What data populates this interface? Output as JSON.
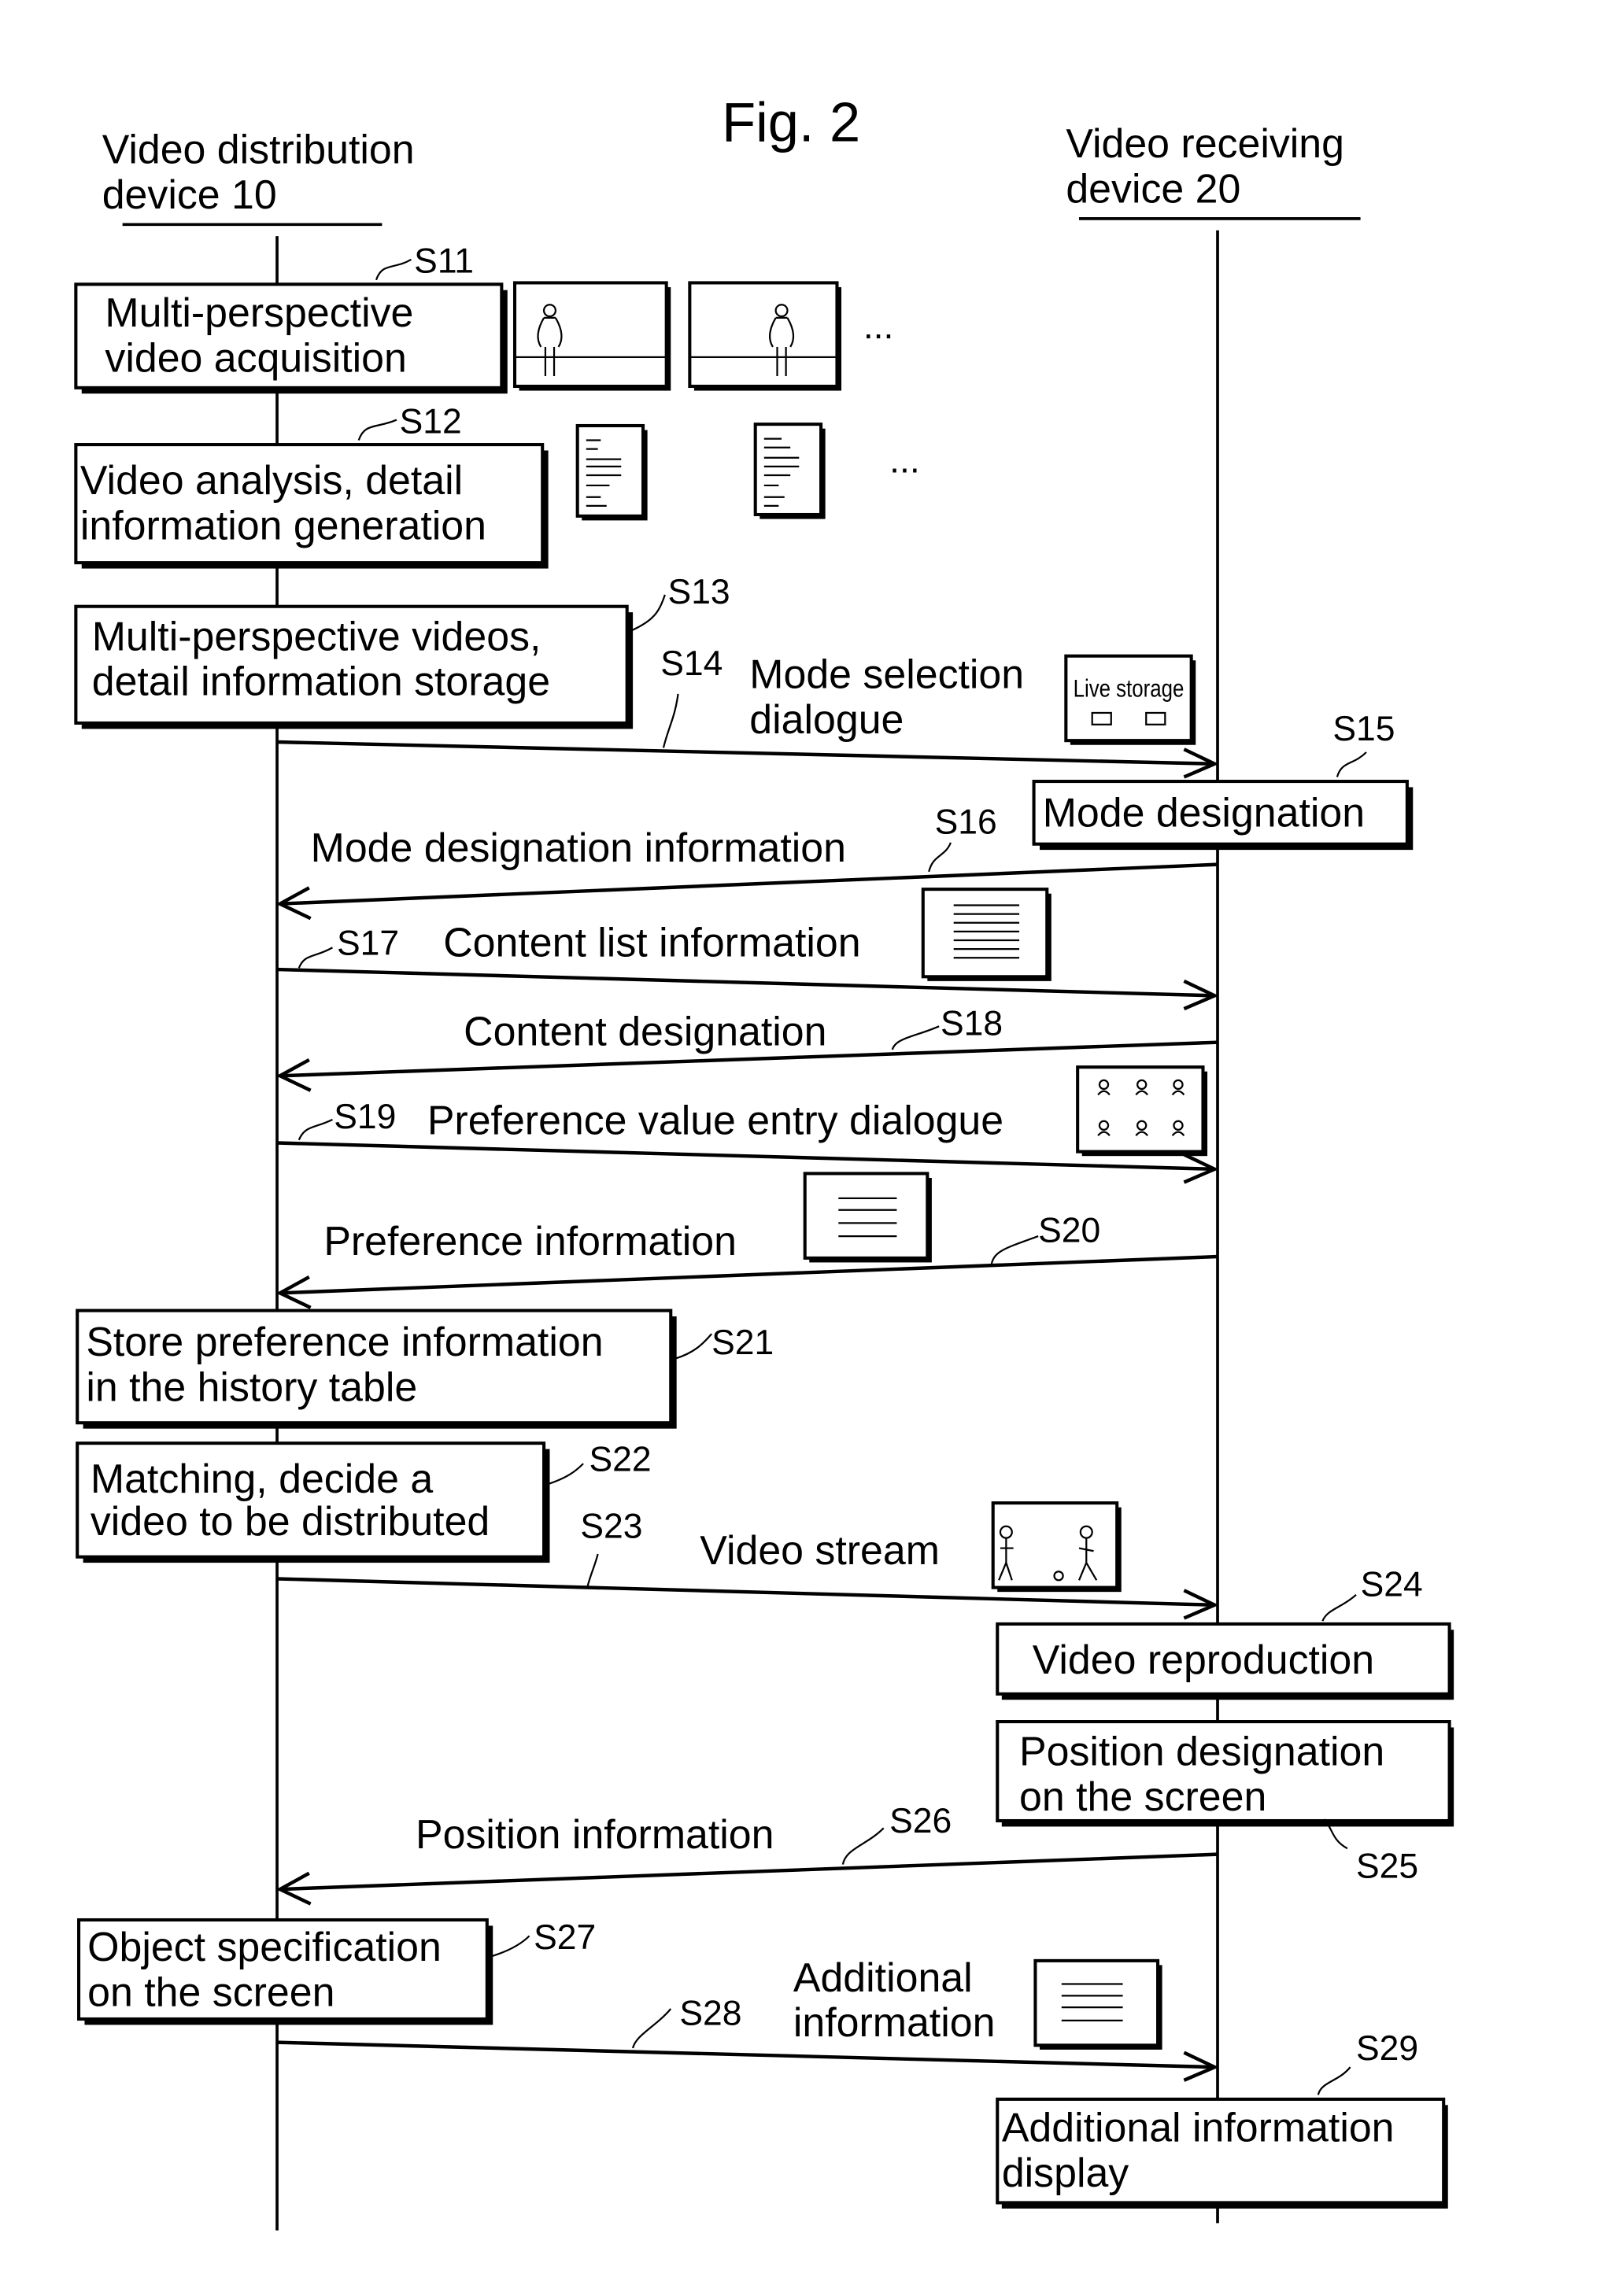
{
  "figure": {
    "title": "Fig. 2",
    "lanes": {
      "left": {
        "line1": "Video distribution",
        "line2": "device 10"
      },
      "right": {
        "line1": "Video receiving",
        "line2": "device 20"
      }
    },
    "steps": {
      "S11": {
        "id": "S11",
        "line1": "Multi-perspective",
        "line2": "video acquisition"
      },
      "S12": {
        "id": "S12",
        "line1": "Video analysis, detail",
        "line2": "information generation"
      },
      "S13": {
        "id": "S13",
        "line1": "Multi-perspective videos,",
        "line2": "detail information storage"
      },
      "S14": {
        "id": "S14",
        "line1": "Mode selection",
        "line2": "dialogue",
        "icon_text": "Live storage"
      },
      "S15": {
        "id": "S15",
        "line1": "Mode designation"
      },
      "S16": {
        "id": "S16",
        "line1": "Mode designation information"
      },
      "S17": {
        "id": "S17",
        "line1": "Content list information"
      },
      "S18": {
        "id": "S18",
        "line1": "Content designation"
      },
      "S19": {
        "id": "S19",
        "line1": "Preference value entry dialogue"
      },
      "S20": {
        "id": "S20",
        "line1": "Preference information"
      },
      "S21": {
        "id": "S21",
        "line1": "Store preference information",
        "line2": "in the history table"
      },
      "S22": {
        "id": "S22",
        "line1": "Matching, decide a",
        "line2": "video to be distributed"
      },
      "S23": {
        "id": "S23",
        "line1": "Video stream"
      },
      "S24": {
        "id": "S24",
        "line1": "Video reproduction"
      },
      "S25": {
        "id": "S25",
        "line1": "Position designation",
        "line2": "on the screen"
      },
      "S26": {
        "id": "S26",
        "line1": "Position information"
      },
      "S27": {
        "id": "S27",
        "line1": "Object specification",
        "line2": "on the screen"
      },
      "S28": {
        "id": "S28",
        "line1": "Additional",
        "line2": "information"
      },
      "S29": {
        "id": "S29",
        "line1": "Additional information",
        "line2": "display"
      }
    },
    "ellipsis": "..."
  }
}
